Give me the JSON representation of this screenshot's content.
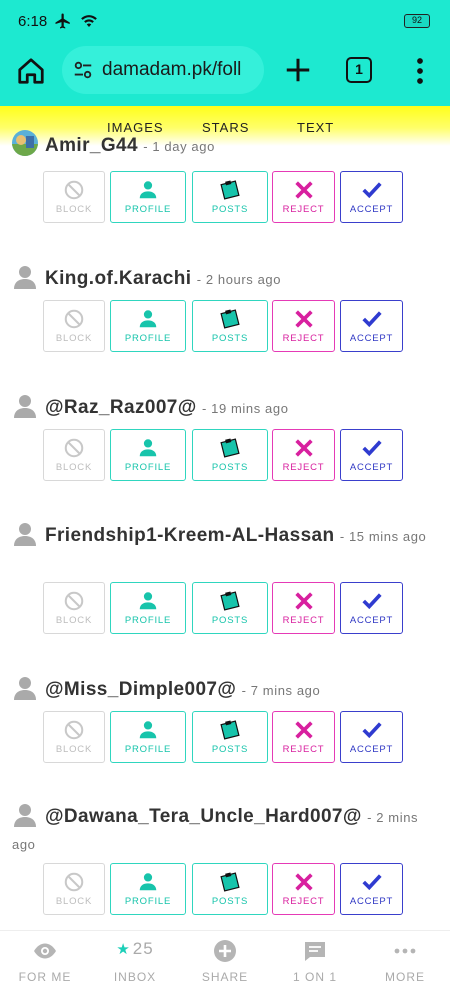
{
  "status_bar": {
    "time": "6:18",
    "battery": "92"
  },
  "browser": {
    "url": "damadam.pk/foll",
    "tab_count": "1"
  },
  "tabs": [
    "IMAGES",
    "STARS",
    "TEXT"
  ],
  "actions": {
    "block": "BLOCK",
    "profile": "PROFILE",
    "posts": "POSTS",
    "reject": "REJECT",
    "accept": "ACCEPT"
  },
  "requests": [
    {
      "username": "Amir_G44",
      "time": "- 1 day ago",
      "avatar": "photo-avatar"
    },
    {
      "username": "King.of.Karachi",
      "time": "- 2 hours ago",
      "avatar": "default-avatar"
    },
    {
      "username": "@Raz_Raz007@",
      "time": "- 19 mins ago",
      "avatar": "default-avatar"
    },
    {
      "username": "Friendship1-Kreem-AL-Hassan",
      "time": "- 15 mins ago",
      "avatar": "default-avatar"
    },
    {
      "username": "@Miss_Dimple007@",
      "time": "- 7 mins ago",
      "avatar": "default-avatar"
    },
    {
      "username": "@Dawana_Tera_Uncle_Hard007@",
      "time": "- 2 mins ago",
      "avatar": "default-avatar"
    }
  ],
  "bottom_nav": {
    "for_me": "FOR ME",
    "inbox": "INBOX",
    "inbox_count": "25",
    "share": "SHARE",
    "one_on_one": "1 ON 1",
    "more": "MORE"
  },
  "colors": {
    "accent": "#1de9d0",
    "tab_strip": "#ffff1a",
    "reject": "#e53ab6",
    "accept": "#3a3fcc"
  }
}
